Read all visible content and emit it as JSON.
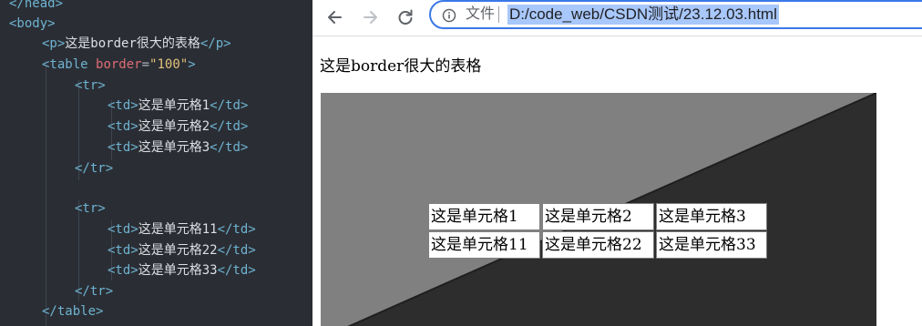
{
  "editor": {
    "lines": [
      {
        "segments": [
          {
            "c": "tag",
            "t": "</head>"
          }
        ]
      },
      {
        "segments": [
          {
            "c": "tag",
            "t": "<body>"
          }
        ]
      },
      {
        "segments": [
          {
            "c": "tag",
            "t": "<p>"
          },
          {
            "c": "txt",
            "t": "这是border很大的表格"
          },
          {
            "c": "tag",
            "t": "</p>"
          }
        ]
      },
      {
        "segments": [
          {
            "c": "tag",
            "t": "<table "
          },
          {
            "c": "attr",
            "t": "border"
          },
          {
            "c": "eq",
            "t": "="
          },
          {
            "c": "str",
            "t": "\"100\""
          },
          {
            "c": "tag",
            "t": ">"
          }
        ]
      },
      {
        "segments": [
          {
            "c": "tag",
            "t": "<tr>"
          }
        ]
      },
      {
        "segments": [
          {
            "c": "tag",
            "t": "<td>"
          },
          {
            "c": "txt",
            "t": "这是单元格1"
          },
          {
            "c": "tag",
            "t": "</td>"
          }
        ]
      },
      {
        "segments": [
          {
            "c": "tag",
            "t": "<td>"
          },
          {
            "c": "txt",
            "t": "这是单元格2"
          },
          {
            "c": "tag",
            "t": "</td>"
          }
        ]
      },
      {
        "segments": [
          {
            "c": "tag",
            "t": "<td>"
          },
          {
            "c": "txt",
            "t": "这是单元格3"
          },
          {
            "c": "tag",
            "t": "</td>"
          }
        ]
      },
      {
        "segments": [
          {
            "c": "tag",
            "t": "</tr>"
          }
        ]
      },
      {
        "segments": []
      },
      {
        "segments": [
          {
            "c": "tag",
            "t": "<tr>"
          }
        ]
      },
      {
        "segments": [
          {
            "c": "tag",
            "t": "<td>"
          },
          {
            "c": "txt",
            "t": "这是单元格11"
          },
          {
            "c": "tag",
            "t": "</td>"
          }
        ]
      },
      {
        "segments": [
          {
            "c": "tag",
            "t": "<td>"
          },
          {
            "c": "txt",
            "t": "这是单元格22"
          },
          {
            "c": "tag",
            "t": "</td>"
          }
        ]
      },
      {
        "segments": [
          {
            "c": "tag",
            "t": "<td>"
          },
          {
            "c": "txt",
            "t": "这是单元格33"
          },
          {
            "c": "tag",
            "t": "</td>"
          }
        ]
      },
      {
        "segments": [
          {
            "c": "tag",
            "t": "</tr>"
          }
        ]
      },
      {
        "segments": [
          {
            "c": "tag",
            "t": "</table>"
          }
        ]
      }
    ]
  },
  "browser": {
    "back_icon": "back-arrow-icon",
    "forward_icon": "forward-arrow-icon",
    "reload_icon": "reload-icon",
    "info_icon": "info-icon",
    "scheme_label": "文件",
    "url": "D:/code_web/CSDN测试/23.12.03.html"
  },
  "page": {
    "paragraph": "这是border很大的表格",
    "table": {
      "rows": [
        [
          "这是单元格1",
          "这是单元格2",
          "这是单元格3"
        ],
        [
          "这是单元格11",
          "这是单元格22",
          "这是单元格33"
        ]
      ]
    }
  },
  "colors": {
    "editor_bg": "#2a2e34",
    "tag": "#6fb3d2",
    "attr": "#e06c75",
    "string": "#e5c07b",
    "border_light": "#808080",
    "border_dark": "#2d2d2d",
    "url_highlight": "#a8c7fa",
    "omnibox_focus": "#3b78e7"
  }
}
